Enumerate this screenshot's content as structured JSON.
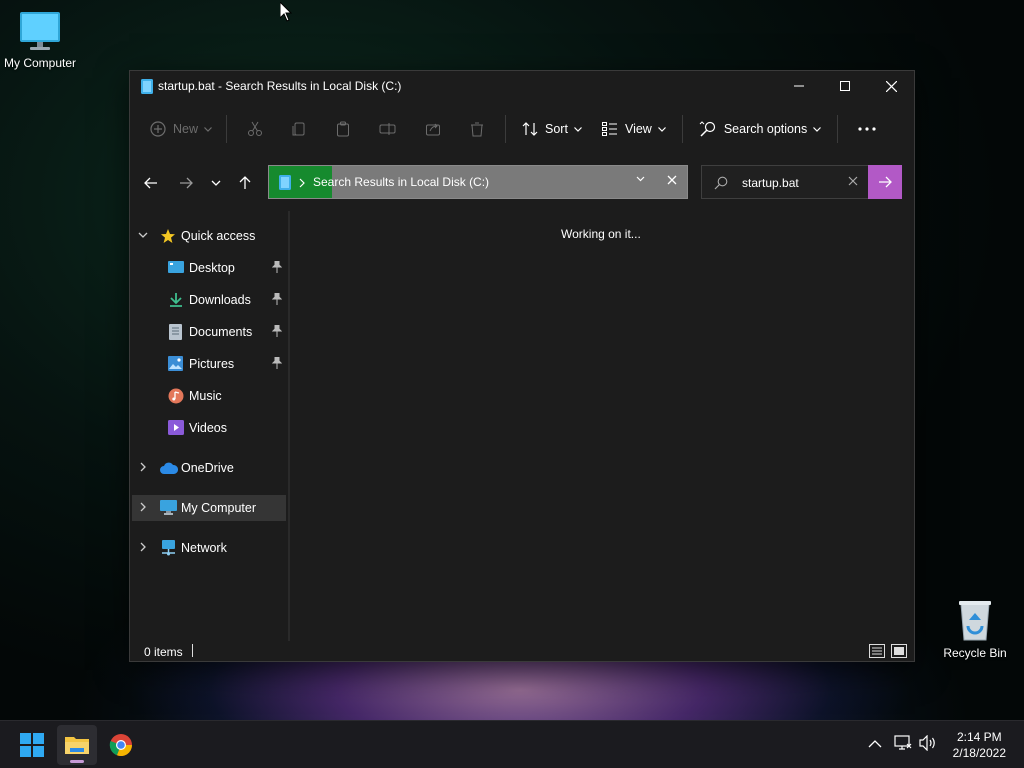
{
  "desktop": {
    "icons": [
      {
        "label": "My Computer"
      },
      {
        "label": "Recycle Bin"
      }
    ]
  },
  "window": {
    "title": "startup.bat - Search Results in Local Disk (C:)",
    "toolbar": {
      "new_label": "New",
      "sort_label": "Sort",
      "view_label": "View",
      "search_options_label": "Search options"
    },
    "address": {
      "path_label": "Search Results in Local Disk (C:)",
      "progress": 0.15
    },
    "search": {
      "value": "startup.bat"
    },
    "navpane": {
      "quick_access": "Quick access",
      "items": [
        {
          "label": "Desktop",
          "pinned": true
        },
        {
          "label": "Downloads",
          "pinned": true
        },
        {
          "label": "Documents",
          "pinned": true
        },
        {
          "label": "Pictures",
          "pinned": true
        },
        {
          "label": "Music",
          "pinned": false
        },
        {
          "label": "Videos",
          "pinned": false
        }
      ],
      "onedrive": "OneDrive",
      "my_computer": "My Computer",
      "network": "Network"
    },
    "content": {
      "message": "Working on it..."
    },
    "status": {
      "items_count": "0 items"
    }
  },
  "taskbar": {
    "time": "2:14 PM",
    "date": "2/18/2022"
  },
  "colors": {
    "accent_search": "#b259c6",
    "address_progress": "#168a2e",
    "window_bg": "#1c1c1c"
  }
}
